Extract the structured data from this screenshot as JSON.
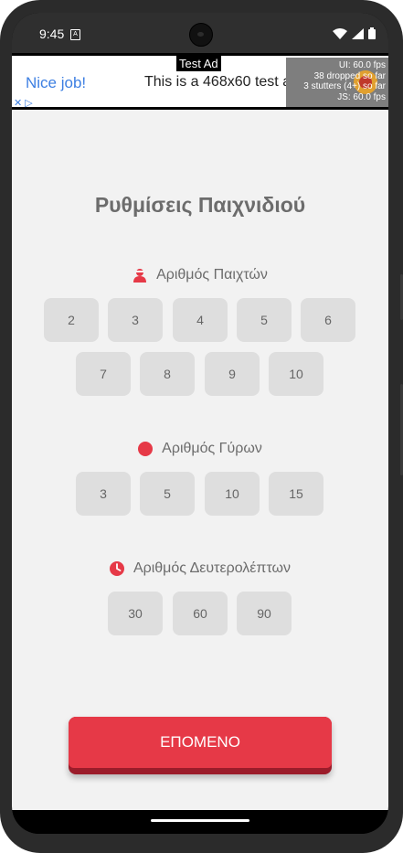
{
  "status_bar": {
    "time": "9:45",
    "sim_glyph": "A"
  },
  "ad": {
    "label": "Test Ad",
    "nice_text": "Nice job!",
    "body_text": "This is a 468x60 test ad.",
    "choices_glyph": "✕ ▷",
    "fps_lines": [
      "UI: 60.0 fps",
      "38 dropped so far",
      "3 stutters (4+) so far",
      "JS: 60.0 fps"
    ]
  },
  "title": "Ρυθμίσεις Παιχνιδιού",
  "players": {
    "label": "Αριθμός Παιχτών",
    "options": [
      "2",
      "3",
      "4",
      "5",
      "6",
      "7",
      "8",
      "9",
      "10"
    ]
  },
  "rounds": {
    "label": "Αριθμός Γύρων",
    "options": [
      "3",
      "5",
      "10",
      "15"
    ]
  },
  "seconds": {
    "label": "Αριθμός Δευτερολέπτων",
    "options": [
      "30",
      "60",
      "90"
    ]
  },
  "next_button": "ΕΠΟΜΕΝΟ",
  "colors": {
    "accent": "#e63947",
    "accent_dark": "#9b1c2a",
    "option_bg": "#dedede",
    "page_bg": "#f2f2f2"
  }
}
